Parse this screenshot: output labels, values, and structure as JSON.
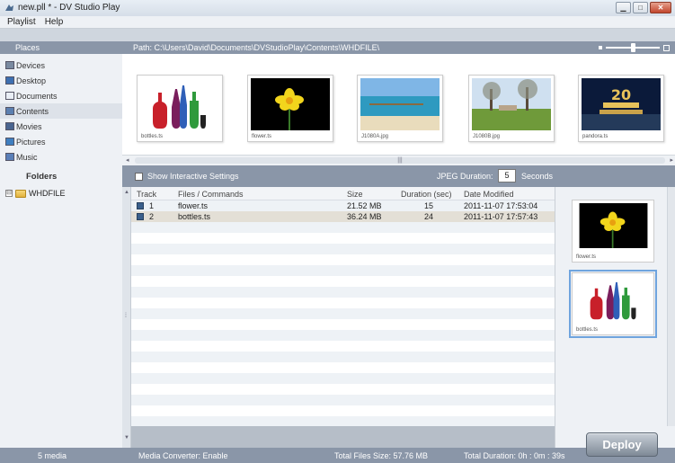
{
  "window": {
    "title": "new.pll * - DV Studio Play"
  },
  "menu": [
    "Playlist",
    "Help"
  ],
  "places": {
    "header": "Places",
    "items": [
      {
        "label": "Devices",
        "icon": "devices-icon"
      },
      {
        "label": "Desktop",
        "icon": "desktop-icon"
      },
      {
        "label": "Documents",
        "icon": "documents-icon"
      },
      {
        "label": "Contents",
        "icon": "contents-icon",
        "selected": true
      },
      {
        "label": "Movies",
        "icon": "movies-icon"
      },
      {
        "label": "Pictures",
        "icon": "pictures-icon"
      },
      {
        "label": "Music",
        "icon": "music-icon"
      }
    ],
    "folders_label": "Folders",
    "tree": [
      {
        "label": "WHDFILE",
        "toggle": "⊟"
      }
    ]
  },
  "pathbar": {
    "text": "Path: C:\\Users\\David\\Documents\\DVStudioPlay\\Contents\\WHDFILE\\",
    "zoom_level": 0.5
  },
  "thumbnails": [
    {
      "caption": "bottles.ts",
      "kind": "bottles"
    },
    {
      "caption": "flower.ts",
      "kind": "flower"
    },
    {
      "caption": "J1080A.jpg",
      "kind": "beach"
    },
    {
      "caption": "J1080B.jpg",
      "kind": "park"
    },
    {
      "caption": "pandora.ts",
      "kind": "fox"
    }
  ],
  "settings": {
    "show_interactive_label": "Show Interactive Settings",
    "jpeg_label": "JPEG Duration:",
    "jpeg_value": "5",
    "jpeg_unit": "Seconds"
  },
  "table": {
    "columns": [
      "Track",
      "Files / Commands",
      "Size",
      "Duration (sec)",
      "Date Modified"
    ],
    "rows": [
      {
        "track": "1",
        "file": "flower.ts",
        "size": "21.52 MB",
        "duration": "15",
        "date": "2011-11-07 17:53:04"
      },
      {
        "track": "2",
        "file": "bottles.ts",
        "size": "36.24 MB",
        "duration": "24",
        "date": "2011-11-07 17:57:43"
      }
    ]
  },
  "preview": [
    {
      "caption": "flower.ts",
      "kind": "flower"
    },
    {
      "caption": "bottles.ts",
      "kind": "bottles",
      "selected": true
    }
  ],
  "status": {
    "media_count": "5 media",
    "converter": "Media Converter: Enable",
    "total_size": "Total Files Size: 57.76 MB",
    "total_duration": "Total Duration: 0h : 0m : 39s"
  },
  "deploy_label": "Deploy"
}
